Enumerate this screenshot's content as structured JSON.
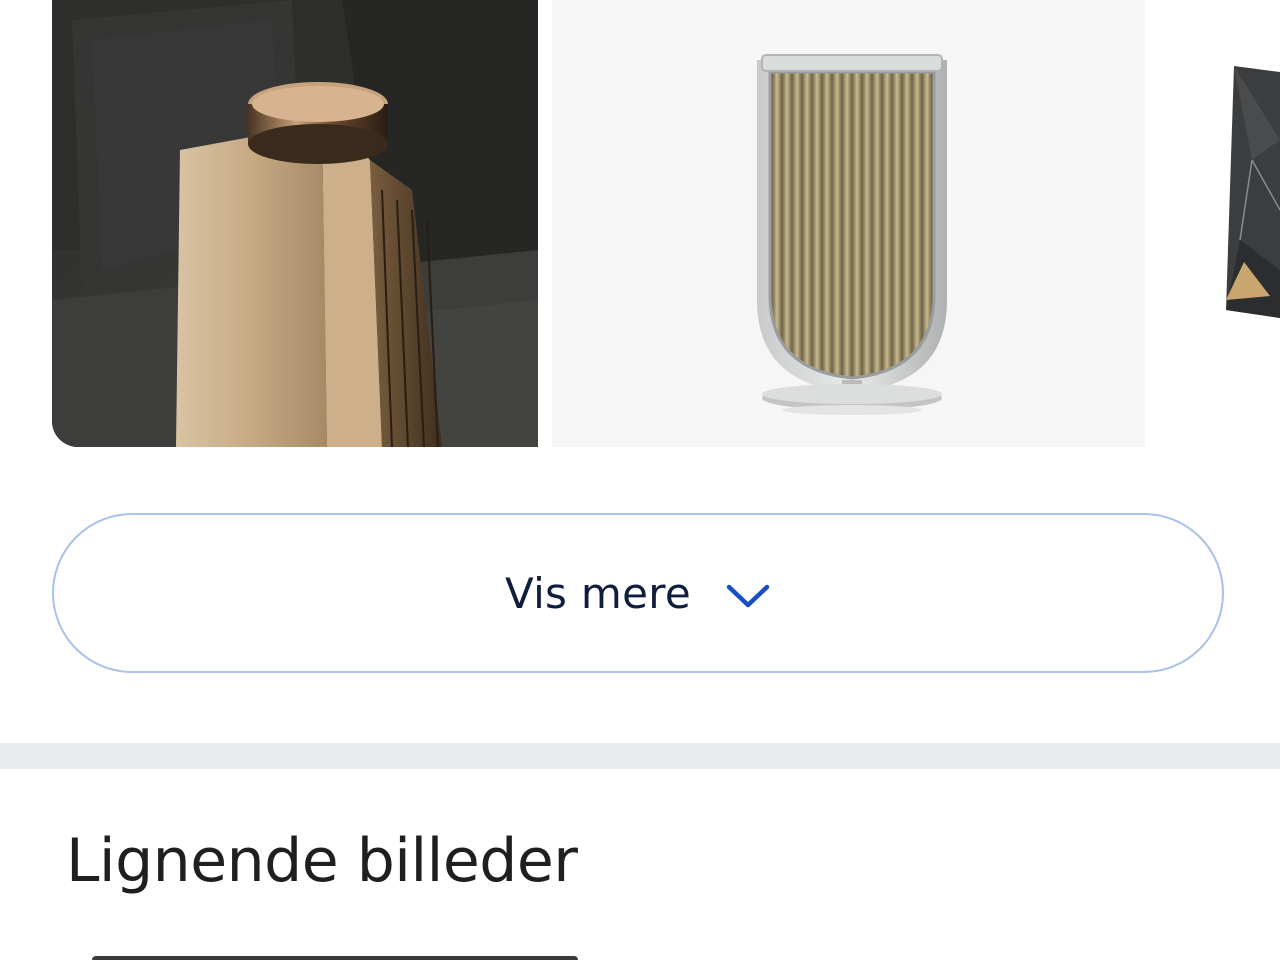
{
  "results": {
    "images": [
      {
        "alt": "Bronze floor speaker with cylindrical top"
      },
      {
        "alt": "Gold pleated speaker on round silver stand"
      },
      {
        "alt": "Dark angular faceted speaker"
      }
    ]
  },
  "show_more": {
    "label": "Vis mere",
    "icon": "chevron-down-icon",
    "border_color": "#a8c2ec",
    "icon_color": "#1a4fc4"
  },
  "similar_images": {
    "title": "Lignende billeder"
  }
}
